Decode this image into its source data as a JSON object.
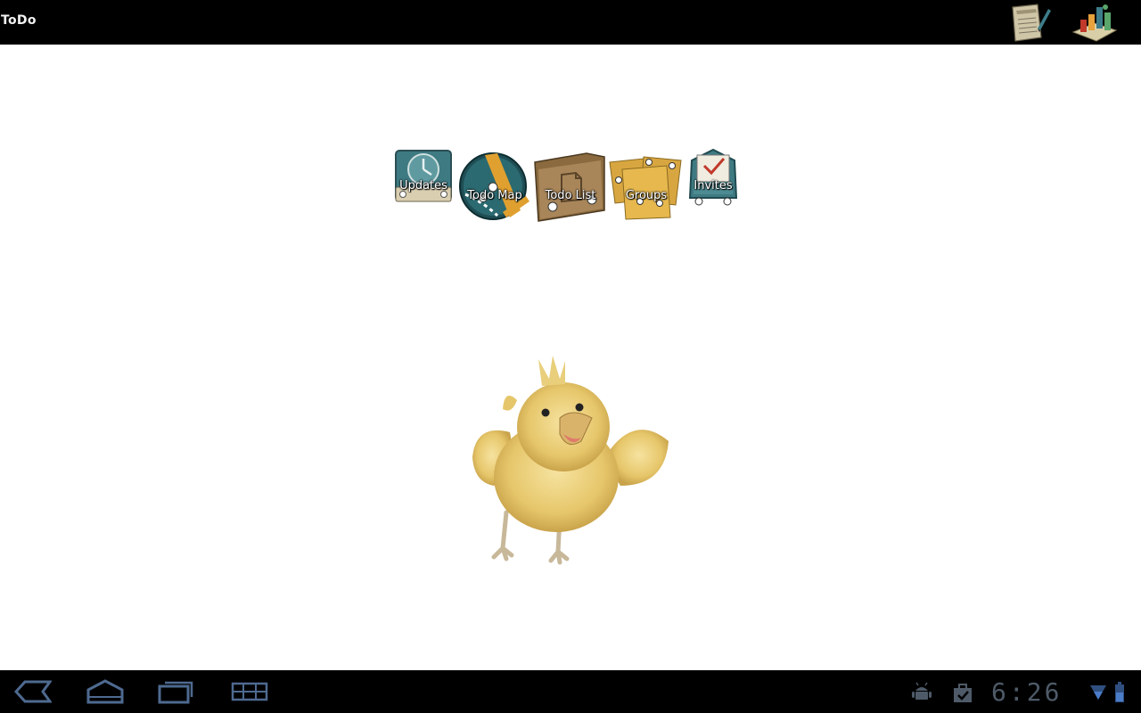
{
  "app": {
    "title": "ToDo"
  },
  "action_bar": {
    "icons": [
      {
        "name": "notes-icon"
      },
      {
        "name": "stats-chart-icon"
      }
    ]
  },
  "menu": {
    "items": [
      {
        "label": "Updates",
        "icon": "clock-icon"
      },
      {
        "label": "Todo Map",
        "icon": "map-icon"
      },
      {
        "label": "Todo List",
        "icon": "folder-icon"
      },
      {
        "label": "Groups",
        "icon": "cards-icon"
      },
      {
        "label": "Invites",
        "icon": "invite-icon"
      }
    ]
  },
  "mascot": {
    "name": "chick-mascot"
  },
  "system_bar": {
    "time": "6:26",
    "nav": [
      "back-icon",
      "home-icon",
      "recent-apps-icon",
      "menu-grid-icon"
    ],
    "tray": [
      "android-debug-icon",
      "store-bag-icon",
      "wifi-icon",
      "battery-icon"
    ]
  },
  "colors": {
    "bar": "#000000",
    "accent": "#33b5e5",
    "sysbar_icons": "#4e5a68"
  }
}
